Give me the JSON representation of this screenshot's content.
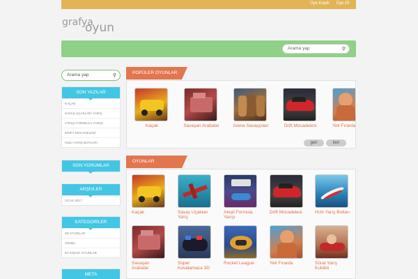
{
  "topbar": {
    "link1": "Üye Kaydı",
    "link2": "Üye Ol"
  },
  "logo": {
    "line1": "grafya",
    "line2": "oyun"
  },
  "nav_search": {
    "placeholder": "Arama yap"
  },
  "sidebar": {
    "search_placeholder": "Arama yap",
    "widgets": {
      "son_yazilar": {
        "title": "SON YAZILAR",
        "items": [
          "KAÇAK",
          "SAVAŞ UÇAKLARI YARIŞ",
          "ATEŞLİ FORMULA YARIŞI",
          "DRIFT MÜCADELESİ",
          "HIZLI YARIŞ BOTLARI"
        ]
      },
      "son_yorumlar": {
        "title": "SON YORUMLAR"
      },
      "arsivler": {
        "title": "ARŞİVLER",
        "items": [
          "OCAK 2017"
        ]
      },
      "kategoriler": {
        "title": "KATEGORİLER",
        "items": [
          "3D OYUNLAR",
          "GENEL",
          "İKİ KİŞİLİK OYUNLAR"
        ]
      },
      "meta": {
        "title": "META"
      }
    }
  },
  "popular": {
    "title": "POPÜLER OYUNLAR",
    "games": [
      "Kaçak",
      "Savaşan Arabalar",
      "Arena Savaşçıları",
      "Drift Mücadelesi",
      "Yeti Fırarda"
    ],
    "prev_label": "geri",
    "next_label": "ileri"
  },
  "games_section": {
    "title": "OYUNLAR",
    "row1": [
      "Kaçak",
      "Savaş Uçakları Yarış",
      "Ateşli Formula Yarışı",
      "Drift Mücadelesi",
      "Hızlı Yarış Botları"
    ],
    "row2": [
      "Savaşan Arabalar",
      "Süper Kovalamaca 3D",
      "Rocket League",
      "Yeti Fırarda",
      "Sürat Yarış Kulübü"
    ]
  },
  "colors": {
    "topbar": "#e2b455",
    "navbar": "#8fd186",
    "widget_title": "#42c6e4",
    "section_tab": "#e2764e",
    "game_title": "#e07045"
  }
}
